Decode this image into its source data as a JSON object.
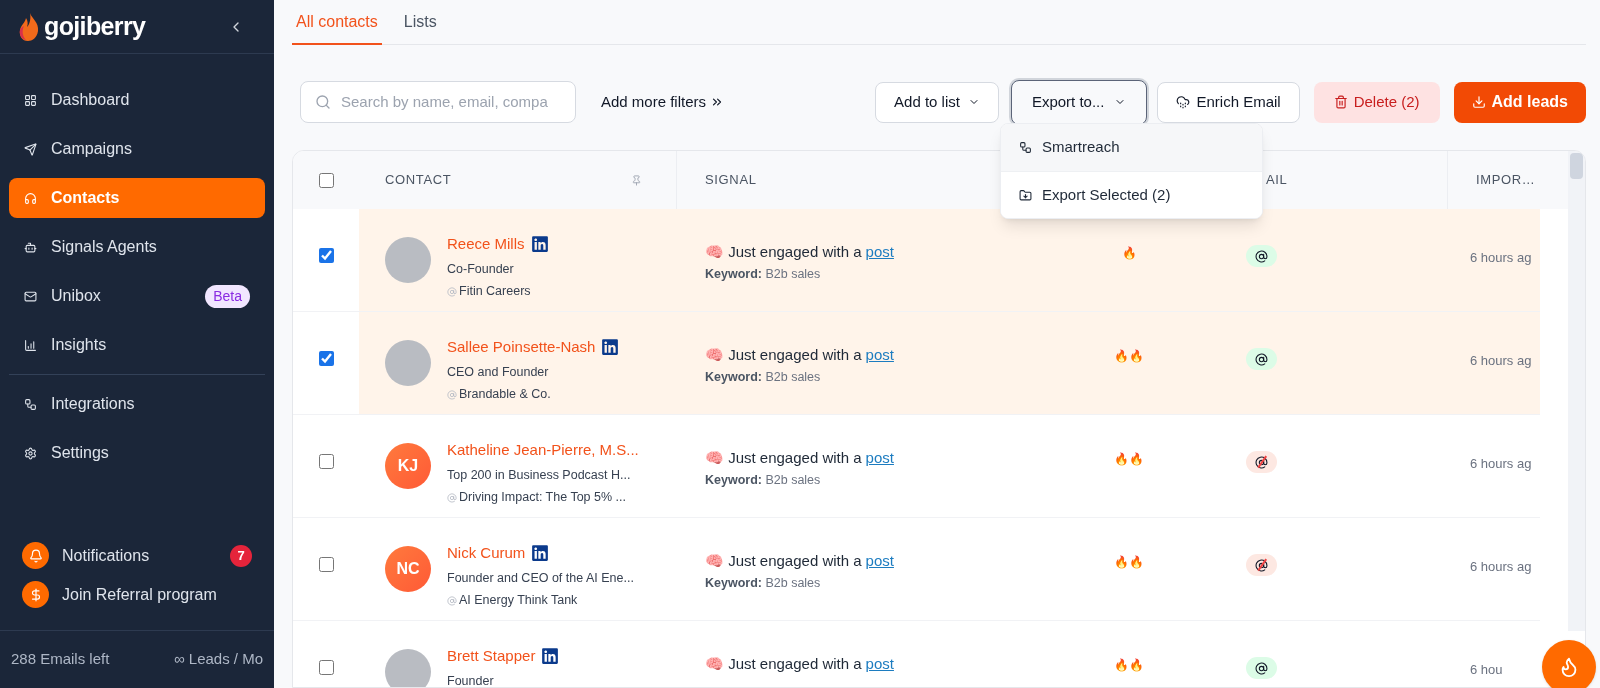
{
  "brand": {
    "name": "gojiberry"
  },
  "sidebar": {
    "nav_groups": [
      [
        {
          "label": "Dashboard",
          "selected": false
        },
        {
          "label": "Campaigns",
          "selected": false
        },
        {
          "label": "Contacts",
          "selected": true
        },
        {
          "label": "Signals Agents",
          "selected": false
        },
        {
          "label": "Unibox",
          "selected": false,
          "badge": "Beta"
        },
        {
          "label": "Insights",
          "selected": false
        }
      ],
      [
        {
          "label": "Integrations",
          "selected": false
        },
        {
          "label": "Settings",
          "selected": false
        }
      ]
    ],
    "notifications": {
      "label": "Notifications",
      "count": "7"
    },
    "referral": {
      "label": "Join Referral program"
    },
    "footer": {
      "emails": "288 Emails left",
      "leads": "∞ Leads / Mo"
    }
  },
  "tabs": [
    {
      "label": "All contacts",
      "selected": true
    },
    {
      "label": "Lists",
      "selected": false
    }
  ],
  "toolbar": {
    "search": {
      "placeholder": "Search by name, email, compa"
    },
    "filters": "Add more filters",
    "add_to_list": "Add to list",
    "export": {
      "label": "Export to...",
      "expanded": true
    },
    "enrich": "Enrich Email",
    "delete": "Delete (2)",
    "add_leads": "Add leads"
  },
  "export_menu": [
    {
      "label": "Smartreach",
      "highlighted": true
    },
    {
      "label": "Export Selected (2)",
      "highlighted": false
    }
  ],
  "table": {
    "select_all": {
      "checked": false
    },
    "columns": [
      "CONTACT",
      "SIGNAL",
      "",
      "AIL",
      "IMPOR…"
    ],
    "rows": [
      {
        "selected": true,
        "avatar": {
          "kind": "photo"
        },
        "name": "Reece Mills",
        "linkedin": true,
        "title": "Co-Founder",
        "company": "Fitin Careers",
        "signal": "🧠 Just engaged with a",
        "link": "post",
        "keyword": "**Keyword:** B2b sales",
        "heat": "🔥",
        "email_found": true,
        "imported": "6 hours ag"
      },
      {
        "selected": true,
        "avatar": {
          "kind": "photo"
        },
        "name": "Sallee Poinsette-Nash",
        "linkedin": true,
        "title": "CEO and Founder",
        "company": "Brandable & Co.",
        "signal": "🧠 Just engaged with a",
        "link": "post",
        "keyword": "**Keyword:** B2b sales",
        "heat": "🔥🔥",
        "email_found": true,
        "imported": "6 hours ag"
      },
      {
        "selected": false,
        "avatar": {
          "kind": "initials",
          "text": "KJ"
        },
        "name": "Katheline Jean-Pierre, M.S...",
        "linkedin": false,
        "title": "Top 200 in Business Podcast H...",
        "company": "Driving Impact: The Top 5% ...",
        "signal": "🧠 Just engaged with a",
        "link": "post",
        "keyword": "**Keyword:** B2b sales",
        "heat": "🔥🔥",
        "email_found": false,
        "imported": "6 hours ag"
      },
      {
        "selected": false,
        "avatar": {
          "kind": "initials",
          "text": "NC"
        },
        "name": "Nick Curum",
        "linkedin": true,
        "title": "Founder and CEO of the AI Ene...",
        "company": "AI Energy Think Tank",
        "signal": "🧠 Just engaged with a",
        "link": "post",
        "keyword": "**Keyword:** B2b sales",
        "heat": "🔥🔥",
        "email_found": false,
        "imported": "6 hours ag"
      },
      {
        "selected": false,
        "avatar": {
          "kind": "photo"
        },
        "name": "Brett Stapper",
        "linkedin": true,
        "title": "Founder",
        "signal": "🧠 Just engaged with a",
        "link": "post",
        "heat": "🔥🔥",
        "email_found": true,
        "imported": "6 hou"
      }
    ]
  }
}
